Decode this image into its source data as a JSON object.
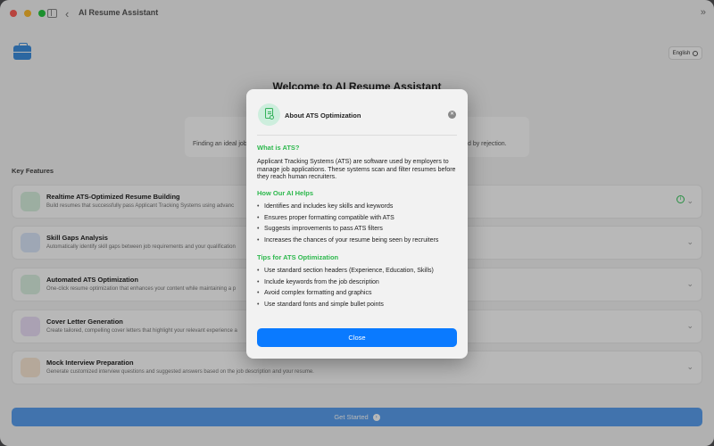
{
  "app": {
    "title": "AI Resume Assistant",
    "language_label": "English"
  },
  "main": {
    "welcome_title": "Welcome to AI Resume Assistant",
    "intro_left": "Finding an ideal job",
    "intro_right": "trated by rejection.",
    "key_features_label": "Key Features",
    "features": [
      {
        "title": "Realtime ATS-Optimized Resume Building",
        "desc": "Build resumes that successfully pass Applicant Tracking Systems using advanc",
        "icon": "resume-check-icon",
        "color": "#d8f2df",
        "info": "i"
      },
      {
        "title": "Skill Gaps Analysis",
        "desc": "Automatically identify skill gaps between job requirements and your qualification",
        "icon": "skills-document-icon",
        "color": "#dbe8fb"
      },
      {
        "title": "Automated ATS Optimization",
        "desc": "One-click resume optimization that enhances your content while maintaining a p",
        "icon": "magic-wand-icon",
        "color": "#dcf1e2"
      },
      {
        "title": "Cover Letter Generation",
        "desc": "Create tailored, compelling cover letters that highlight your relevant experience a",
        "icon": "letter-icon",
        "color": "#ecdff8"
      },
      {
        "title": "Mock Interview Preparation",
        "desc": "Generate customized interview questions and suggested answers based on the job description and your resume.",
        "icon": "interview-icon",
        "color": "#fbe9d6"
      }
    ],
    "get_started_label": "Get Started"
  },
  "modal": {
    "title": "About ATS Optimization",
    "what_heading": "What is ATS?",
    "what_text": "Applicant Tracking Systems (ATS) are software used by employers to manage job applications. These systems scan and filter resumes before they reach human recruiters.",
    "how_heading": "How Our AI Helps",
    "how_items": [
      "Identifies and includes key skills and keywords",
      "Ensures proper formatting compatible with ATS",
      "Suggests improvements to pass ATS filters",
      "Increases the chances of your resume being seen by recruiters"
    ],
    "tips_heading": "Tips for ATS Optimization",
    "tips_items": [
      "Use standard section headers (Experience, Education, Skills)",
      "Include keywords from the job description",
      "Avoid complex formatting and graphics",
      "Use standard fonts and simple bullet points"
    ],
    "close_label": "Close"
  }
}
